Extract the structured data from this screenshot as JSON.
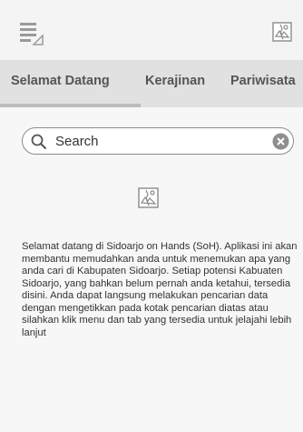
{
  "tabs": [
    {
      "label": "Selamat Datang",
      "active": true
    },
    {
      "label": "Kerajinan",
      "active": false
    },
    {
      "label": "Pariwisata",
      "active": false
    }
  ],
  "search": {
    "placeholder": "Search"
  },
  "content": {
    "welcome_text": "Selamat datang di Sidoarjo on Hands (SoH). Aplikasi ini akan membantu memudahkan anda untuk menemukan apa yang anda cari di Kabupaten Sidoarjo. Setiap potensi Kabuaten Sidoarjo, yang bahkan belum pernah anda ketahui, tersedia disini. Anda dapat langsung melakukan pencarian data dengan mengetikkan pada kotak pencarian diatas atau silahkan klik menu dan tab yang tersedia untuk jelajahi lebih lanjut"
  },
  "icons": {
    "menu": "menu-list-icon",
    "header_logo": "broken-image-icon",
    "search": "search-icon",
    "clear": "clear-icon",
    "content_logo": "broken-image-icon"
  },
  "colors": {
    "tab_bar": "#e1e1e1",
    "tab_indicator": "#bdbdbd",
    "tab_text": "#555555",
    "background": "#f7f7f7"
  }
}
